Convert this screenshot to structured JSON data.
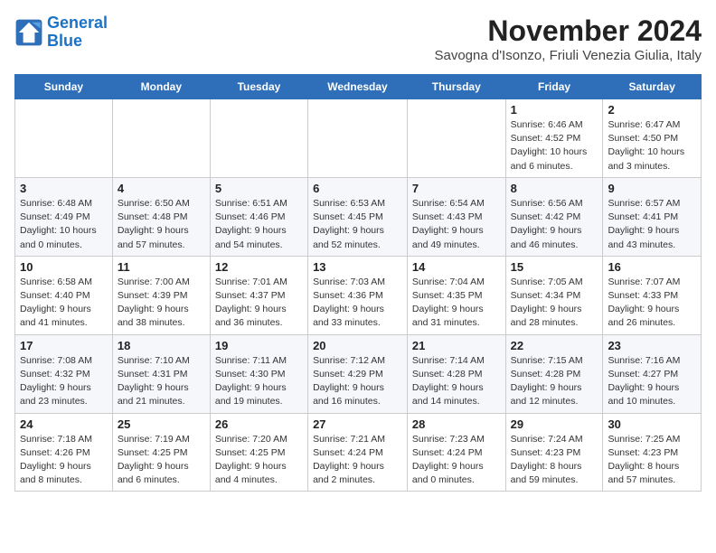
{
  "logo": {
    "line1": "General",
    "line2": "Blue"
  },
  "title": "November 2024",
  "location": "Savogna d'Isonzo, Friuli Venezia Giulia, Italy",
  "weekdays": [
    "Sunday",
    "Monday",
    "Tuesday",
    "Wednesday",
    "Thursday",
    "Friday",
    "Saturday"
  ],
  "weeks": [
    [
      {
        "day": "",
        "info": ""
      },
      {
        "day": "",
        "info": ""
      },
      {
        "day": "",
        "info": ""
      },
      {
        "day": "",
        "info": ""
      },
      {
        "day": "",
        "info": ""
      },
      {
        "day": "1",
        "info": "Sunrise: 6:46 AM\nSunset: 4:52 PM\nDaylight: 10 hours\nand 6 minutes."
      },
      {
        "day": "2",
        "info": "Sunrise: 6:47 AM\nSunset: 4:50 PM\nDaylight: 10 hours\nand 3 minutes."
      }
    ],
    [
      {
        "day": "3",
        "info": "Sunrise: 6:48 AM\nSunset: 4:49 PM\nDaylight: 10 hours\nand 0 minutes."
      },
      {
        "day": "4",
        "info": "Sunrise: 6:50 AM\nSunset: 4:48 PM\nDaylight: 9 hours\nand 57 minutes."
      },
      {
        "day": "5",
        "info": "Sunrise: 6:51 AM\nSunset: 4:46 PM\nDaylight: 9 hours\nand 54 minutes."
      },
      {
        "day": "6",
        "info": "Sunrise: 6:53 AM\nSunset: 4:45 PM\nDaylight: 9 hours\nand 52 minutes."
      },
      {
        "day": "7",
        "info": "Sunrise: 6:54 AM\nSunset: 4:43 PM\nDaylight: 9 hours\nand 49 minutes."
      },
      {
        "day": "8",
        "info": "Sunrise: 6:56 AM\nSunset: 4:42 PM\nDaylight: 9 hours\nand 46 minutes."
      },
      {
        "day": "9",
        "info": "Sunrise: 6:57 AM\nSunset: 4:41 PM\nDaylight: 9 hours\nand 43 minutes."
      }
    ],
    [
      {
        "day": "10",
        "info": "Sunrise: 6:58 AM\nSunset: 4:40 PM\nDaylight: 9 hours\nand 41 minutes."
      },
      {
        "day": "11",
        "info": "Sunrise: 7:00 AM\nSunset: 4:39 PM\nDaylight: 9 hours\nand 38 minutes."
      },
      {
        "day": "12",
        "info": "Sunrise: 7:01 AM\nSunset: 4:37 PM\nDaylight: 9 hours\nand 36 minutes."
      },
      {
        "day": "13",
        "info": "Sunrise: 7:03 AM\nSunset: 4:36 PM\nDaylight: 9 hours\nand 33 minutes."
      },
      {
        "day": "14",
        "info": "Sunrise: 7:04 AM\nSunset: 4:35 PM\nDaylight: 9 hours\nand 31 minutes."
      },
      {
        "day": "15",
        "info": "Sunrise: 7:05 AM\nSunset: 4:34 PM\nDaylight: 9 hours\nand 28 minutes."
      },
      {
        "day": "16",
        "info": "Sunrise: 7:07 AM\nSunset: 4:33 PM\nDaylight: 9 hours\nand 26 minutes."
      }
    ],
    [
      {
        "day": "17",
        "info": "Sunrise: 7:08 AM\nSunset: 4:32 PM\nDaylight: 9 hours\nand 23 minutes."
      },
      {
        "day": "18",
        "info": "Sunrise: 7:10 AM\nSunset: 4:31 PM\nDaylight: 9 hours\nand 21 minutes."
      },
      {
        "day": "19",
        "info": "Sunrise: 7:11 AM\nSunset: 4:30 PM\nDaylight: 9 hours\nand 19 minutes."
      },
      {
        "day": "20",
        "info": "Sunrise: 7:12 AM\nSunset: 4:29 PM\nDaylight: 9 hours\nand 16 minutes."
      },
      {
        "day": "21",
        "info": "Sunrise: 7:14 AM\nSunset: 4:28 PM\nDaylight: 9 hours\nand 14 minutes."
      },
      {
        "day": "22",
        "info": "Sunrise: 7:15 AM\nSunset: 4:28 PM\nDaylight: 9 hours\nand 12 minutes."
      },
      {
        "day": "23",
        "info": "Sunrise: 7:16 AM\nSunset: 4:27 PM\nDaylight: 9 hours\nand 10 minutes."
      }
    ],
    [
      {
        "day": "24",
        "info": "Sunrise: 7:18 AM\nSunset: 4:26 PM\nDaylight: 9 hours\nand 8 minutes."
      },
      {
        "day": "25",
        "info": "Sunrise: 7:19 AM\nSunset: 4:25 PM\nDaylight: 9 hours\nand 6 minutes."
      },
      {
        "day": "26",
        "info": "Sunrise: 7:20 AM\nSunset: 4:25 PM\nDaylight: 9 hours\nand 4 minutes."
      },
      {
        "day": "27",
        "info": "Sunrise: 7:21 AM\nSunset: 4:24 PM\nDaylight: 9 hours\nand 2 minutes."
      },
      {
        "day": "28",
        "info": "Sunrise: 7:23 AM\nSunset: 4:24 PM\nDaylight: 9 hours\nand 0 minutes."
      },
      {
        "day": "29",
        "info": "Sunrise: 7:24 AM\nSunset: 4:23 PM\nDaylight: 8 hours\nand 59 minutes."
      },
      {
        "day": "30",
        "info": "Sunrise: 7:25 AM\nSunset: 4:23 PM\nDaylight: 8 hours\nand 57 minutes."
      }
    ]
  ]
}
